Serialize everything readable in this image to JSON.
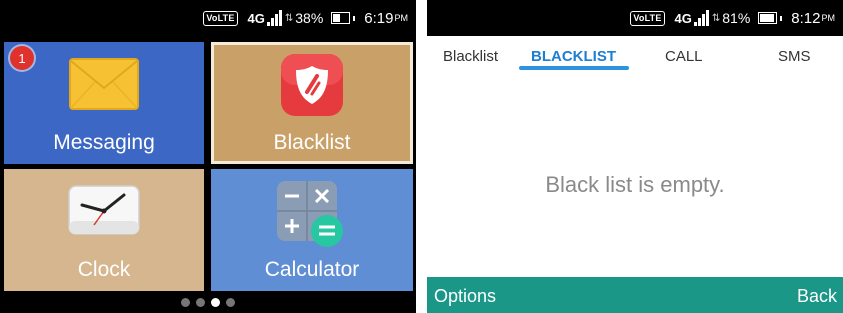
{
  "left_screen": {
    "status": {
      "volte": "VoLTE",
      "network": "4G",
      "battery": "38%",
      "battery_level": 0.38,
      "time": "6:19",
      "ampm": "PM"
    },
    "tiles": [
      {
        "label": "Messaging",
        "icon": "envelope-icon",
        "badge": "1",
        "color": "#3d67c4"
      },
      {
        "label": "Blacklist",
        "icon": "shield-block-icon",
        "color": "#c9a068"
      },
      {
        "label": "Clock",
        "icon": "clock-icon",
        "color": "#d6b68f"
      },
      {
        "label": "Calculator",
        "icon": "calculator-icon",
        "color": "#5f8ed4"
      }
    ],
    "page_indicator": {
      "total": 4,
      "active": 3
    }
  },
  "right_screen": {
    "status": {
      "volte": "VoLTE",
      "network": "4G",
      "battery": "81%",
      "battery_level": 0.81,
      "time": "8:12",
      "ampm": "PM"
    },
    "tabs": [
      {
        "label": "Blacklist",
        "active": false
      },
      {
        "label": "BLACKLIST",
        "active": true
      },
      {
        "label": "CALL",
        "active": false
      },
      {
        "label": "SMS",
        "active": false
      }
    ],
    "empty_message": "Black list is empty.",
    "softkeys": {
      "left": "Options",
      "right": "Back"
    },
    "accent_color": "#1a9787"
  }
}
